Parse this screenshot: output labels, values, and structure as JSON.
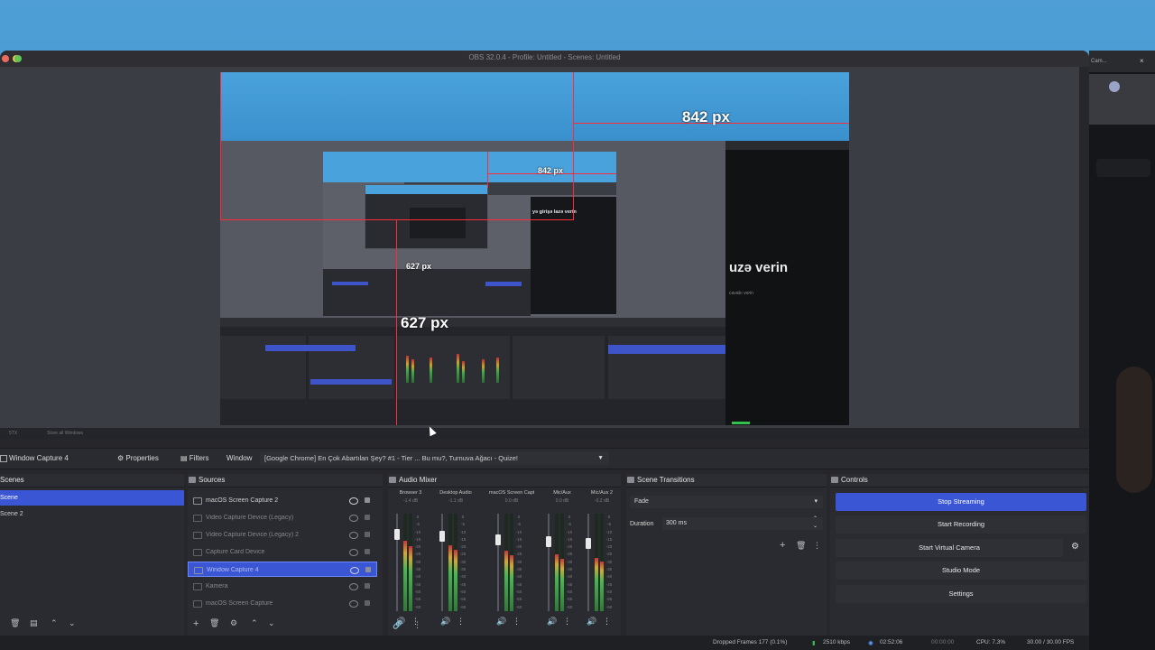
{
  "window": {
    "title": "OBS 32.0.4 - Profile: Untitled - Scenes: Untitled"
  },
  "preview": {
    "measure_large_w": "842 px",
    "measure_large_h": "627 px",
    "measure_small_w": "842 px",
    "measure_small_h": "627 px",
    "content_text_large": "uzə verin",
    "content_subtext_large": "cavabı verin",
    "content_text_small": "yə girişə lazə verin"
  },
  "dim_bar": {
    "left_text": "5TX",
    "mid_text": "Store all Windows"
  },
  "toolbar": {
    "source_name": "Window Capture 4",
    "properties_label": "Properties",
    "filters_label": "Filters",
    "window_label": "Window",
    "window_value": "[Google Chrome] En Çok Abartılan Şey? #1 - Tier ... Bu mu?, Turnuva Ağacı - Quize!"
  },
  "scenes": {
    "title": "Scenes",
    "items": [
      "Scene",
      "Scene 2"
    ],
    "selected_index": 0
  },
  "sources": {
    "title": "Sources",
    "items": [
      "macOS Screen Capture 2",
      "Video Capture Device (Legacy)",
      "Video Capture Device (Legacy) 2",
      "Capture Card Device",
      "Window Capture 4",
      "Kamera",
      "macOS Screen Capture"
    ],
    "selected_index": 4
  },
  "audio_mixer": {
    "title": "Audio Mixer",
    "channels": [
      {
        "name": "Browser 3",
        "db": "-1.4 dB",
        "level": 0.72
      },
      {
        "name": "Desktop Audio",
        "db": "-1.1 dB",
        "level": 0.68
      },
      {
        "name": "macOS Screen Captur",
        "db": "0.0 dB",
        "level": 0.62
      },
      {
        "name": "Mic/Aux",
        "db": "0.0 dB",
        "level": 0.58
      },
      {
        "name": "Mic/Aux 2",
        "db": "-0.2 dB",
        "level": 0.55
      }
    ]
  },
  "scene_transitions": {
    "title": "Scene Transitions",
    "transition": "Fade",
    "duration_label": "Duration",
    "duration_value": "300 ms"
  },
  "controls": {
    "title": "Controls",
    "buttons": [
      "Stop Streaming",
      "Start Recording",
      "Start Virtual Camera",
      "Studio Mode",
      "Settings"
    ]
  },
  "status": {
    "dropped_frames": "Dropped Frames 177 (0.1%)",
    "bitrate": "2510 kbps",
    "stream_time": "02:52:06",
    "rec_time": "00:00:00",
    "cpu": "CPU: 7.3%",
    "fps": "30.00 / 30.00 FPS"
  },
  "right_window": {
    "title": "Cam..."
  },
  "colors": {
    "accent": "#3a56d4",
    "measure_red": "#ff2b3a",
    "bg": "#27272b"
  }
}
